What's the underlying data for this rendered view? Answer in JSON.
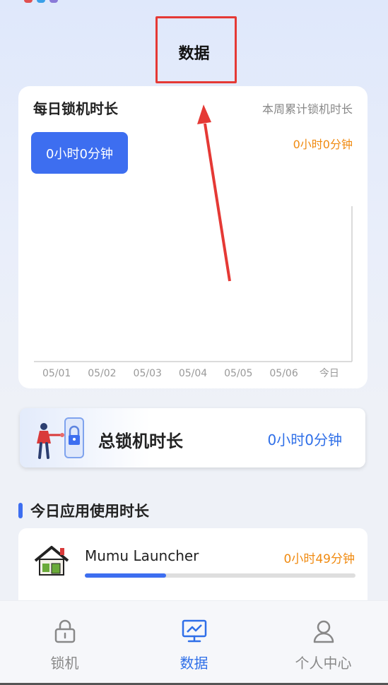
{
  "header": {
    "title": "数据"
  },
  "daily": {
    "title": "每日锁机时长",
    "weekly_label": "本周累计锁机时长",
    "today_value": "0小时0分钟",
    "weekly_value": "0小时0分钟"
  },
  "chart_data": {
    "type": "bar",
    "categories": [
      "05/01",
      "05/02",
      "05/03",
      "05/04",
      "05/05",
      "05/06",
      "今日"
    ],
    "values": [
      0,
      0,
      0,
      0,
      0,
      0,
      0
    ],
    "title": "",
    "xlabel": "",
    "ylabel": ""
  },
  "total": {
    "label": "总锁机时长",
    "value": "0小时0分钟"
  },
  "today_usage": {
    "title": "今日应用使用时长",
    "apps": [
      {
        "name": "Mumu Launcher",
        "duration": "0小时49分钟",
        "progress": 0.3
      }
    ]
  },
  "tabs": [
    {
      "label": "锁机",
      "icon": "lock-icon",
      "active": false
    },
    {
      "label": "数据",
      "icon": "chart-monitor-icon",
      "active": true
    },
    {
      "label": "个人中心",
      "icon": "user-icon",
      "active": false
    }
  ],
  "colors": {
    "accent": "#3d6ef0",
    "orange": "#f08a10",
    "annotation_red": "#e53935"
  }
}
